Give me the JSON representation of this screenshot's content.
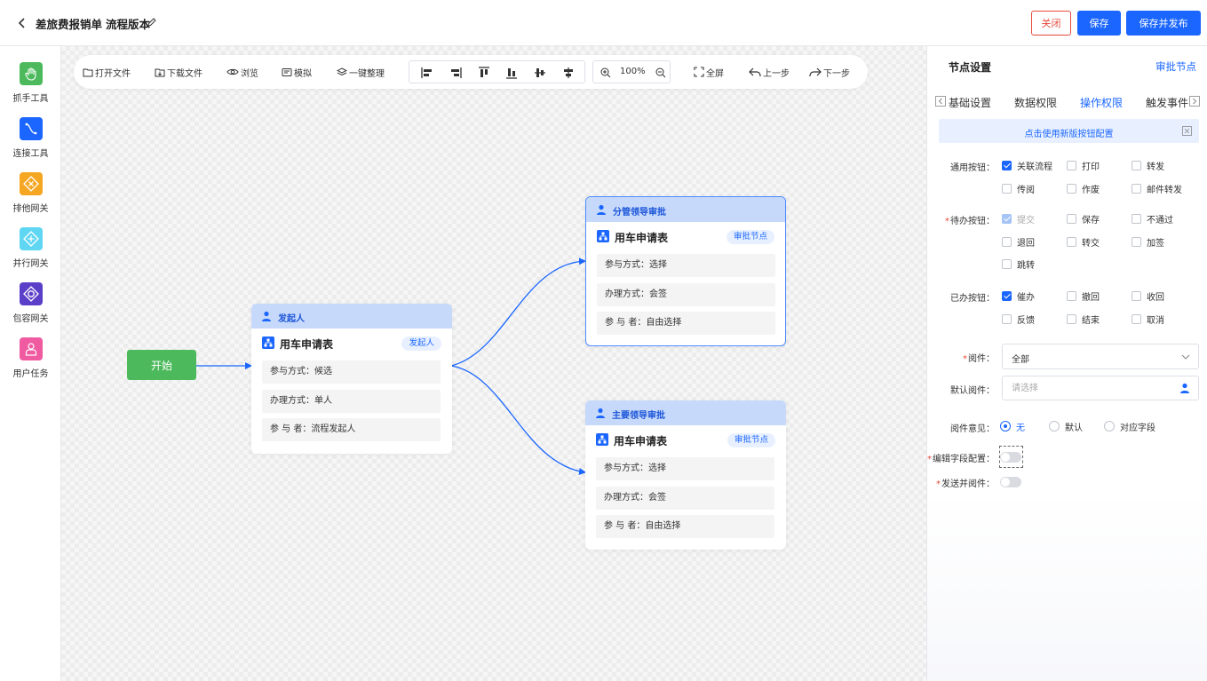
{
  "header": {
    "doc_title": "差旅费报销单",
    "version_title": "流程版本",
    "close_label": "关闭",
    "save_label": "保存",
    "publish_label": "保存并发布"
  },
  "toolbox": [
    {
      "label": "抓手工具",
      "icon": "hand-icon",
      "color": "#4cba5c"
    },
    {
      "label": "连接工具",
      "icon": "connect-icon",
      "color": "#1a66ff"
    },
    {
      "label": "排他网关",
      "icon": "exclusive-gateway-icon",
      "color": "#f5a623"
    },
    {
      "label": "并行网关",
      "icon": "parallel-gateway-icon",
      "color": "#5fd6f2"
    },
    {
      "label": "包容网关",
      "icon": "inclusive-gateway-icon",
      "color": "#5b3fc8"
    },
    {
      "label": "用户任务",
      "icon": "user-task-icon",
      "color": "#f05aa0"
    }
  ],
  "canvas_toolbar": {
    "open_file": "打开文件",
    "download_file": "下载文件",
    "browse": "浏览",
    "simulate": "模拟",
    "auto_arrange": "一键整理",
    "zoom": "100%",
    "fullscreen": "全屏",
    "undo": "上一步",
    "redo": "下一步"
  },
  "flow": {
    "start_label": "开始",
    "nodes": [
      {
        "title": "发起人",
        "form": "用车申请表",
        "tag": "发起人",
        "rows": [
          "参与方式：候选",
          "办理方式：单人",
          "参 与 者：流程发起人"
        ]
      },
      {
        "title": "分管领导审批",
        "form": "用车申请表",
        "tag": "审批节点",
        "rows": [
          "参与方式：选择",
          "办理方式：会签",
          "参 与 者：自由选择"
        ]
      },
      {
        "title": "主要领导审批",
        "form": "用车申请表",
        "tag": "审批节点",
        "rows": [
          "参与方式：选择",
          "办理方式：会签",
          "参 与 者：自由选择"
        ]
      }
    ]
  },
  "panel": {
    "title": "节点设置",
    "node_type": "审批节点",
    "tabs": [
      "基础设置",
      "数据权限",
      "操作权限",
      "触发事件"
    ],
    "active_tab": "操作权限",
    "banner": "点击使用新版按钮配置",
    "general_label": "通用按钮：",
    "general_buttons": [
      {
        "label": "关联流程",
        "checked": true
      },
      {
        "label": "打印",
        "checked": false
      },
      {
        "label": "转发",
        "checked": false
      },
      {
        "label": "传阅",
        "checked": false
      },
      {
        "label": "作废",
        "checked": false
      },
      {
        "label": "邮件转发",
        "checked": false
      }
    ],
    "pending_label": "待办按钮：",
    "pending_buttons": [
      {
        "label": "提交",
        "checked": true,
        "disabled": true
      },
      {
        "label": "保存",
        "checked": false
      },
      {
        "label": "不通过",
        "checked": false
      },
      {
        "label": "退回",
        "checked": false
      },
      {
        "label": "转交",
        "checked": false
      },
      {
        "label": "加签",
        "checked": false
      },
      {
        "label": "跳转",
        "checked": false
      }
    ],
    "done_label": "已办按钮：",
    "done_buttons": [
      {
        "label": "催办",
        "checked": true
      },
      {
        "label": "撤回",
        "checked": false
      },
      {
        "label": "收回",
        "checked": false
      },
      {
        "label": "反馈",
        "checked": false
      },
      {
        "label": "结束",
        "checked": false
      },
      {
        "label": "取消",
        "checked": false
      }
    ],
    "reader_label": "阅件：",
    "reader_value": "全部",
    "default_reader_label": "默认阅件：",
    "default_reader_placeholder": "请选择",
    "opinion_label": "阅件意见：",
    "opinion_options": [
      "无",
      "默认",
      "对应字段"
    ],
    "opinion_selected": "无",
    "edit_field_label": "编辑字段配置：",
    "send_reader_label": "发送并阅件："
  },
  "colors": {
    "primary": "#1a66ff",
    "danger": "#e64a3c",
    "start": "#4cba5c",
    "node_header": "#c6d9fb"
  }
}
